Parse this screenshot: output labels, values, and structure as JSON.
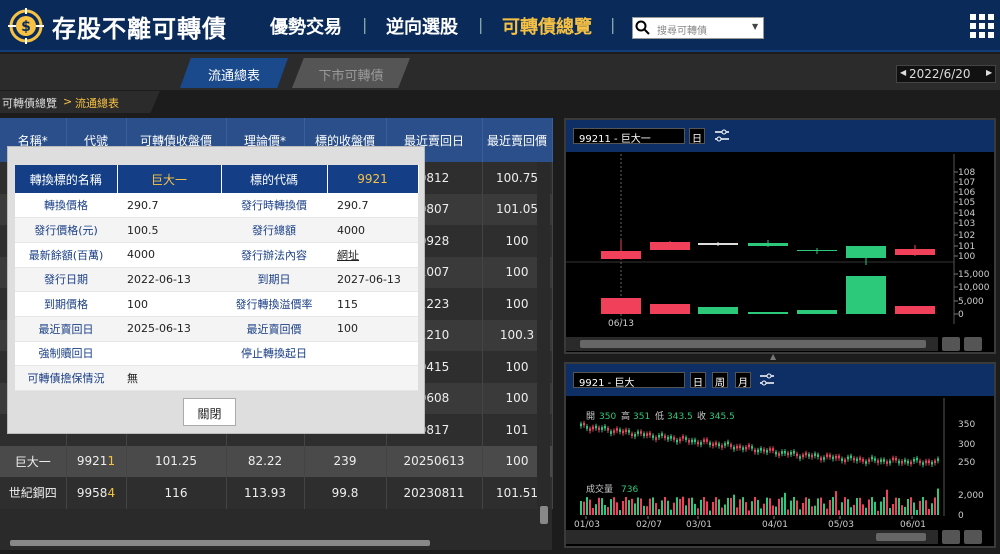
{
  "header": {
    "logo_text": "存股不離可轉債",
    "nav": [
      "優勢交易",
      "逆向選股",
      "可轉債總覽"
    ],
    "search_placeholder": "搜尋可轉債"
  },
  "tabs": [
    "流通總表",
    "下市可轉債"
  ],
  "date": "2022/6/20",
  "breadcrumb": [
    "可轉債總覽",
    "流通總表"
  ],
  "table": {
    "headers": [
      "名稱*",
      "代號",
      "可轉債收盤價",
      "理論價*",
      "標的收盤價",
      "最近賣回日",
      "最近賣回價"
    ],
    "rows": [
      [
        "",
        "",
        "",
        "",
        "",
        "0812",
        "100.75"
      ],
      [
        "",
        "",
        "",
        "",
        "",
        "0807",
        "101.05"
      ],
      [
        "",
        "",
        "",
        "",
        "",
        "0928",
        "100"
      ],
      [
        "",
        "",
        "",
        "",
        "",
        "1007",
        "100"
      ],
      [
        "",
        "",
        "",
        "",
        "",
        "1223",
        "100"
      ],
      [
        "",
        "",
        "",
        "",
        "",
        "1210",
        "100.3"
      ],
      [
        "",
        "",
        "",
        "",
        "",
        "0415",
        "100"
      ],
      [
        "",
        "",
        "",
        "",
        "",
        "0608",
        "100"
      ],
      [
        "",
        "",
        "",
        "",
        "",
        "0817",
        "101"
      ],
      [
        "巨大一",
        "99211",
        "101.25",
        "82.22",
        "239",
        "20250613",
        "100"
      ],
      [
        "世紀鋼四",
        "99584",
        "116",
        "113.93",
        "99.8",
        "20230811",
        "101.51"
      ]
    ]
  },
  "modal": {
    "header": [
      "轉換標的名稱",
      "巨大一",
      "標的代碼",
      "9921"
    ],
    "rows": [
      [
        "轉換價格",
        "290.7",
        "發行時轉換價",
        "290.7"
      ],
      [
        "發行價格(元)",
        "100.5",
        "發行總額",
        "4000"
      ],
      [
        "最新餘額(百萬)",
        "4000",
        "發行辦法內容",
        "網址"
      ],
      [
        "發行日期",
        "2022-06-13",
        "到期日",
        "2027-06-13"
      ],
      [
        "到期價格",
        "100",
        "發行轉換溢價率",
        "115"
      ],
      [
        "最近賣回日",
        "2025-06-13",
        "最近賣回價",
        "100"
      ],
      [
        "強制贖回日",
        "",
        "停止轉換起日",
        ""
      ],
      [
        "可轉債擔保情況",
        "無",
        "",
        ""
      ]
    ],
    "close_label": "關閉"
  },
  "chart1": {
    "name": "99211 - 巨大一",
    "period_btn": "日",
    "y_labels": [
      "108",
      "107",
      "106",
      "105",
      "104",
      "103",
      "102",
      "101",
      "100",
      "15,000",
      "10,000",
      "5,000",
      "0"
    ],
    "date_label": "06/13"
  },
  "chart2": {
    "name": "9921 - 巨大",
    "period_btns": [
      "日",
      "周",
      "月"
    ],
    "ohlc": {
      "open_label": "開",
      "open": "350",
      "high_label": "高",
      "high": "351",
      "low_label": "低",
      "low": "343.5",
      "close_label": "收",
      "close": "345.5"
    },
    "vol_label": "成交量",
    "vol_value": "736",
    "y_labels": [
      "350",
      "300",
      "250",
      "2,000",
      "0"
    ],
    "x_labels": [
      "01/03",
      "02/07",
      "03/01",
      "04/01",
      "05/03",
      "06/01"
    ]
  },
  "chart_data": {
    "type": "bar",
    "categories": [
      "01/03",
      "02/07",
      "03/01",
      "04/01",
      "05/03",
      "06/01"
    ],
    "values": [
      345.5,
      320,
      295,
      270,
      255,
      250
    ],
    "title": "",
    "xlabel": "",
    "ylabel": "",
    "ylim": [
      200,
      360
    ]
  }
}
